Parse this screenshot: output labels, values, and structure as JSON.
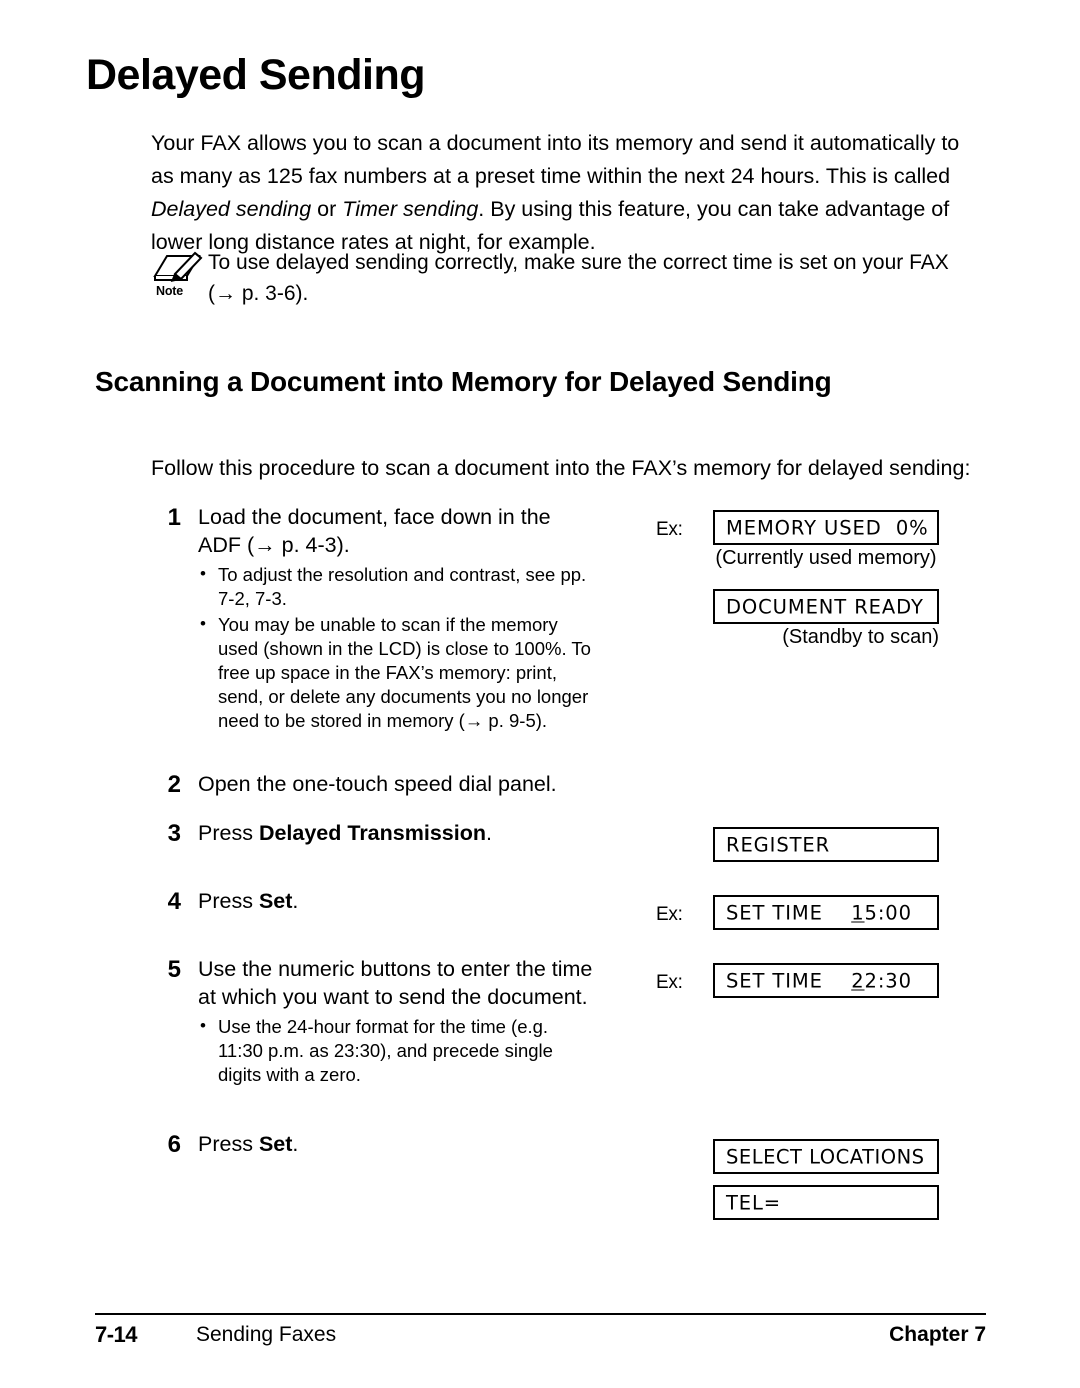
{
  "page": {
    "title": "Delayed Sending"
  },
  "intro": {
    "part1": "Your FAX allows you to scan a document into its memory and send it automatically to as many as 125 fax numbers at a preset time within the next 24 hours. This is called ",
    "italic1": "Delayed sending",
    "part2": " or ",
    "italic2": "Timer sending",
    "part3": ". By using this feature, you can take advantage of lower long distance rates at night, for example."
  },
  "note": {
    "icon": "note-pencil-icon",
    "label": "Note",
    "line1": "To use delayed sending correctly, make sure the correct time is set on your FAX",
    "line2": "(→ p. 3-6)."
  },
  "section": {
    "heading": "Scanning a Document into Memory for Delayed Sending",
    "lead": "Follow this procedure to scan a document into the FAX’s memory for delayed sending:"
  },
  "steps": [
    {
      "number": "1",
      "text": "Load the document, face down in the ADF (→ p. 4-3).",
      "bullets": [
        "To adjust the resolution and contrast, see pp. 7-2, 7-3.",
        "You may be unable to scan if the memory used (shown in the LCD) is close to 100%. To free up space in the FAX’s memory: print, send, or delete any documents you no longer need to be stored in memory (→ p. 9-5)."
      ]
    },
    {
      "number": "2",
      "text": "Open the one-touch speed dial panel.",
      "bullets": []
    },
    {
      "number": "3",
      "text_before": "Press ",
      "text_bold": "Delayed Transmission",
      "text_after": ".",
      "bullets": []
    },
    {
      "number": "4",
      "text_before": "Press ",
      "text_bold": "Set",
      "text_after": ".",
      "bullets": []
    },
    {
      "number": "5",
      "text": "Use the numeric buttons to enter the time at which you want to send the document.",
      "bullets": [
        "Use the 24-hour format for the time (e.g. 11:30 p.m. as 23:30), and precede single digits with a zero."
      ]
    },
    {
      "number": "6",
      "text_before": "Press ",
      "text_bold": "Set",
      "text_after": ".",
      "bullets": []
    }
  ],
  "lcd_displays": [
    {
      "ex_label": "Ex:",
      "has_ex": true,
      "text": "MEMORY USED  0%",
      "caption": "(Currently used memory)",
      "caption_align": "center",
      "cursor": ""
    },
    {
      "ex_label": "",
      "has_ex": false,
      "text": "DOCUMENT READY",
      "caption": "(Standby to scan)",
      "caption_align": "right",
      "cursor": ""
    },
    {
      "ex_label": "",
      "has_ex": false,
      "text": "REGISTER",
      "caption": "",
      "caption_align": "center",
      "cursor": ""
    },
    {
      "ex_label": "Ex:",
      "has_ex": true,
      "text_prefix": "SET TIME    ",
      "cursor": "1",
      "text_suffix": "5:00",
      "caption": "",
      "caption_align": "center"
    },
    {
      "ex_label": "Ex:",
      "has_ex": true,
      "text_prefix": "SET TIME    ",
      "cursor": "2",
      "text_suffix": "2:30",
      "caption": "",
      "caption_align": "center"
    },
    {
      "ex_label": "",
      "has_ex": false,
      "text": "SELECT LOCATIONS",
      "caption": "",
      "caption_align": "center",
      "cursor": ""
    },
    {
      "ex_label": "",
      "has_ex": false,
      "text": "TEL=",
      "caption": "",
      "caption_align": "center",
      "cursor": ""
    }
  ],
  "footer": {
    "page_number": "7-14",
    "section_name": "Sending Faxes",
    "chapter": "Chapter 7"
  },
  "colors": {
    "text": "#000000",
    "background": "#ffffff",
    "border": "#000000"
  }
}
